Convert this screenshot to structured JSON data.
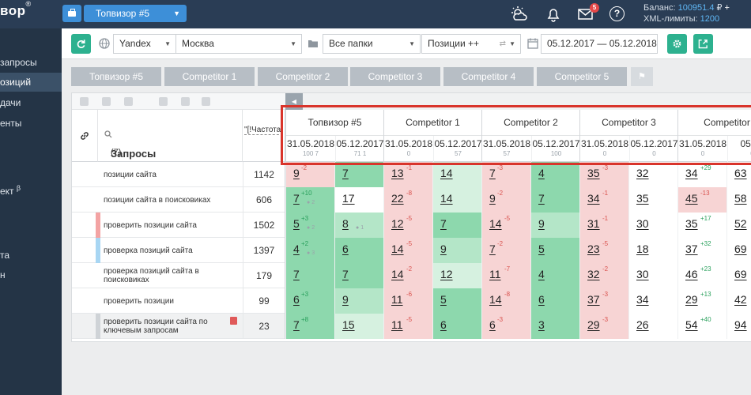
{
  "topbar": {
    "logo": "вор",
    "logo_mark": "®",
    "project": "Топвизор #5",
    "mail_badge": "5",
    "balance_label": "Баланс:",
    "balance_value": "100951.4",
    "currency": "₽",
    "plus": "+",
    "xml_label": "XML-лимиты:",
    "xml_value": "1200",
    "help_glyph": "?"
  },
  "sidebar": {
    "items": [
      "запросы",
      "озиций",
      "дачи",
      "енты",
      "ект",
      "та",
      "н"
    ],
    "beta": "β"
  },
  "toolbar": {
    "engine": "Yandex",
    "region": "Москва",
    "folder": "Все папки",
    "mode": "Позиции ++",
    "date_range": "05.12.2017 — 05.12.2018"
  },
  "tabs": [
    "Топвизор #5",
    "Competitor 1",
    "Competitor 2",
    "Competitor 3",
    "Competitor 4",
    "Competitor 5"
  ],
  "table": {
    "query_header": "Запросы",
    "query_count": "(7)",
    "freq_header": "\"[!Частота]",
    "competitors": [
      {
        "name": "Топвизор #5",
        "dates": [
          {
            "date": "31.05.2018",
            "stats": "100  7"
          },
          {
            "date": "05.12.2017",
            "stats": "71  1"
          }
        ]
      },
      {
        "name": "Competitor 1",
        "dates": [
          {
            "date": "31.05.2018",
            "stats": "0"
          },
          {
            "date": "05.12.2017",
            "stats": "57"
          }
        ]
      },
      {
        "name": "Competitor 2",
        "dates": [
          {
            "date": "31.05.2018",
            "stats": "57"
          },
          {
            "date": "05.12.2017",
            "stats": "100"
          }
        ]
      },
      {
        "name": "Competitor 3",
        "dates": [
          {
            "date": "31.05.2018",
            "stats": "0"
          },
          {
            "date": "05.12.2017",
            "stats": "0"
          }
        ]
      },
      {
        "name": "Competitor",
        "dates": [
          {
            "date": "31.05.2018",
            "stats": "0"
          },
          {
            "date": "05.12",
            "stats": "0"
          }
        ]
      }
    ],
    "rows": [
      {
        "query": "позиции сайта",
        "freq": "1142",
        "mark": "",
        "cells": [
          {
            "p": "9",
            "d": "-2"
          },
          {
            "p": "7",
            "d": ""
          },
          {
            "p": "13",
            "d": "-1"
          },
          {
            "p": "14",
            "d": ""
          },
          {
            "p": "7",
            "d": "-3"
          },
          {
            "p": "4",
            "d": ""
          },
          {
            "p": "35",
            "d": "-3"
          },
          {
            "p": "32",
            "d": ""
          },
          {
            "p": "34",
            "d": "+29"
          },
          {
            "p": "63",
            "d": ""
          }
        ]
      },
      {
        "query": "позиции сайта в поисковиках",
        "freq": "606",
        "mark": "",
        "cells": [
          {
            "p": "7",
            "d": "+10",
            "v": "2"
          },
          {
            "p": "17",
            "d": ""
          },
          {
            "p": "22",
            "d": "-8"
          },
          {
            "p": "14",
            "d": ""
          },
          {
            "p": "9",
            "d": "-2"
          },
          {
            "p": "7",
            "d": ""
          },
          {
            "p": "34",
            "d": "-1"
          },
          {
            "p": "35",
            "d": ""
          },
          {
            "p": "45",
            "d": "-13"
          },
          {
            "p": "58",
            "d": ""
          }
        ]
      },
      {
        "query": "проверить позиции сайта",
        "freq": "1502",
        "mark": "#f3a3a3",
        "cells": [
          {
            "p": "5",
            "d": "+3",
            "v": "2"
          },
          {
            "p": "8",
            "d": "",
            "v": "1"
          },
          {
            "p": "12",
            "d": "-5"
          },
          {
            "p": "7",
            "d": ""
          },
          {
            "p": "14",
            "d": "-5"
          },
          {
            "p": "9",
            "d": ""
          },
          {
            "p": "31",
            "d": "-1"
          },
          {
            "p": "30",
            "d": ""
          },
          {
            "p": "35",
            "d": "+17"
          },
          {
            "p": "52",
            "d": ""
          }
        ]
      },
      {
        "query": "проверка позиций сайта",
        "freq": "1397",
        "mark": "#a8d6f3",
        "cells": [
          {
            "p": "4",
            "d": "+2",
            "v": "3"
          },
          {
            "p": "6",
            "d": ""
          },
          {
            "p": "14",
            "d": "-5"
          },
          {
            "p": "9",
            "d": ""
          },
          {
            "p": "7",
            "d": "-2"
          },
          {
            "p": "5",
            "d": ""
          },
          {
            "p": "23",
            "d": "-5"
          },
          {
            "p": "18",
            "d": ""
          },
          {
            "p": "37",
            "d": "+32"
          },
          {
            "p": "69",
            "d": ""
          }
        ]
      },
      {
        "query": "проверка позиций сайта в поисковиках",
        "freq": "179",
        "mark": "",
        "cells": [
          {
            "p": "7",
            "d": ""
          },
          {
            "p": "7",
            "d": ""
          },
          {
            "p": "14",
            "d": "-2"
          },
          {
            "p": "12",
            "d": ""
          },
          {
            "p": "11",
            "d": "-7"
          },
          {
            "p": "4",
            "d": ""
          },
          {
            "p": "32",
            "d": "-2"
          },
          {
            "p": "30",
            "d": ""
          },
          {
            "p": "46",
            "d": "+23"
          },
          {
            "p": "69",
            "d": ""
          }
        ]
      },
      {
        "query": "проверить позиции",
        "freq": "99",
        "mark": "",
        "cells": [
          {
            "p": "6",
            "d": "+3"
          },
          {
            "p": "9",
            "d": ""
          },
          {
            "p": "11",
            "d": "-6"
          },
          {
            "p": "5",
            "d": ""
          },
          {
            "p": "14",
            "d": "-8"
          },
          {
            "p": "6",
            "d": ""
          },
          {
            "p": "37",
            "d": "-3"
          },
          {
            "p": "34",
            "d": ""
          },
          {
            "p": "29",
            "d": "+13"
          },
          {
            "p": "42",
            "d": ""
          }
        ]
      },
      {
        "query": "проверить позиции сайта по ключевым запросам",
        "freq": "23",
        "mark": "#cfd3d7",
        "cells": [
          {
            "p": "7",
            "d": "+8"
          },
          {
            "p": "15",
            "d": ""
          },
          {
            "p": "11",
            "d": "-5"
          },
          {
            "p": "6",
            "d": ""
          },
          {
            "p": "6",
            "d": "-3"
          },
          {
            "p": "3",
            "d": ""
          },
          {
            "p": "29",
            "d": "-3"
          },
          {
            "p": "26",
            "d": ""
          },
          {
            "p": "54",
            "d": "+40"
          },
          {
            "p": "94",
            "d": ""
          }
        ]
      }
    ]
  },
  "colors": {
    "green_strong": "#8dd8ad",
    "green_mid": "#b4e6c8",
    "green_light": "#d6f1e0",
    "red_light": "#f7d4d4",
    "highlight": "#d9342b"
  }
}
